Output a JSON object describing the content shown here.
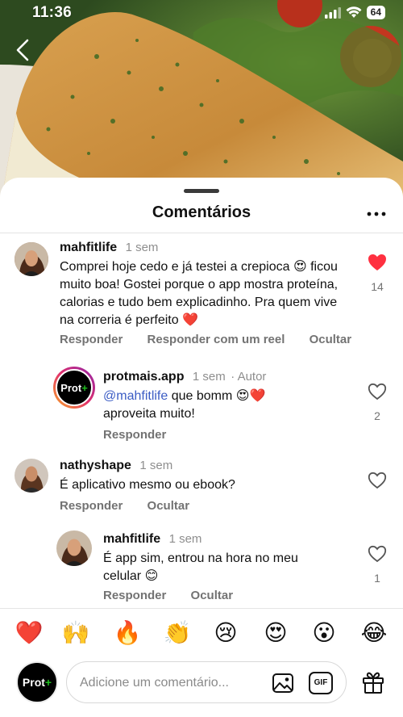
{
  "status_bar": {
    "time": "11:36",
    "battery": "64"
  },
  "sheet": {
    "title": "Comentários"
  },
  "comments": [
    {
      "username": "mahfitlife",
      "time": "1 sem",
      "text": "Comprei hoje cedo e já testei a crepioca 😍 ficou muito boa! Gostei porque o app mostra proteína, calorias e tudo bem explicadinho. Pra quem vive na correria é perfeito ❤️",
      "actions": [
        "Responder",
        "Responder com um reel",
        "Ocultar"
      ],
      "likes": "14",
      "liked": true
    },
    {
      "username": "protmais.app",
      "time": "1 sem",
      "author_badge": "· Autor",
      "mention": "@mahfitlife",
      "text": "que bomm 😍❤️ aproveita muito!",
      "actions": [
        "Responder"
      ],
      "likes": "2",
      "liked": false,
      "avatar_label": "Prot",
      "avatar_plus": "+"
    },
    {
      "username": "nathyshape",
      "time": "1 sem",
      "text": "É aplicativo mesmo ou ebook?",
      "actions": [
        "Responder",
        "Ocultar"
      ],
      "likes": "",
      "liked": false
    },
    {
      "username": "mahfitlife",
      "time": "1 sem",
      "text": "É app sim, entrou na hora no meu celular 😊",
      "actions": [
        "Responder",
        "Ocultar"
      ],
      "likes": "1",
      "liked": false
    }
  ],
  "emoji_bar": [
    "❤️",
    "🙌",
    "🔥",
    "👏",
    "😢",
    "😍",
    "😮",
    "😂"
  ],
  "composer": {
    "avatar_label": "Prot",
    "avatar_plus": "+",
    "placeholder": "Adicione um comentário...",
    "gif_label": "GIF"
  },
  "colors": {
    "like_red": "#ff3040",
    "mention_blue": "#3b5cc4",
    "brand_green": "#1fc01f"
  },
  "icons": [
    "back-chevron-icon",
    "more-icon",
    "heart-icon",
    "image-icon",
    "gift-icon"
  ]
}
